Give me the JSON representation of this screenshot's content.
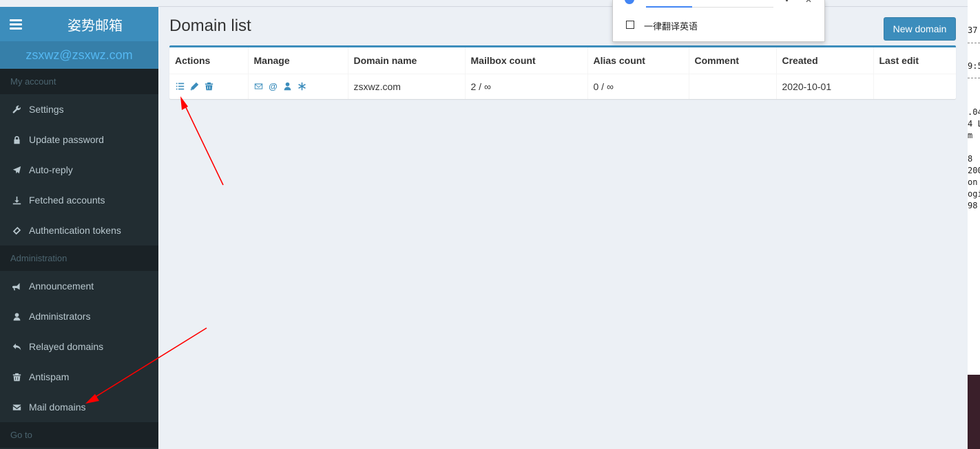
{
  "sidebar": {
    "brand": "姿势邮箱",
    "user_email": "zsxwz@zsxwz.com",
    "sections": [
      {
        "header": "My account",
        "items": [
          {
            "label": "Settings",
            "icon": "wrench-icon"
          },
          {
            "label": "Update password",
            "icon": "lock-icon"
          },
          {
            "label": "Auto-reply",
            "icon": "plane-icon"
          },
          {
            "label": "Fetched accounts",
            "icon": "download-icon"
          },
          {
            "label": "Authentication tokens",
            "icon": "ticket-icon"
          }
        ]
      },
      {
        "header": "Administration",
        "items": [
          {
            "label": "Announcement",
            "icon": "bullhorn-icon"
          },
          {
            "label": "Administrators",
            "icon": "user-icon"
          },
          {
            "label": "Relayed domains",
            "icon": "reply-icon"
          },
          {
            "label": "Antispam",
            "icon": "trash-icon"
          },
          {
            "label": "Mail domains",
            "icon": "envelope-icon"
          }
        ]
      },
      {
        "header": "Go to",
        "items": []
      }
    ]
  },
  "main": {
    "title": "Domain list",
    "new_button_label": "New domain",
    "table": {
      "columns": [
        "Actions",
        "Manage",
        "Domain name",
        "Mailbox count",
        "Alias count",
        "Comment",
        "Created",
        "Last edit"
      ],
      "rows": [
        {
          "actions": [
            "list-icon",
            "pencil-icon",
            "trash-icon"
          ],
          "manage": [
            "envelope-icon",
            "at-icon",
            "user-icon",
            "asterisk-icon"
          ],
          "domain_name": "zsxwz.com",
          "mailbox_count": "2 / ∞",
          "alias_count": "0 / ∞",
          "comment": "",
          "created": "2020-10-01",
          "last_edit": ""
        }
      ]
    }
  },
  "translate_popup": {
    "checkbox_label": "一律翻译英语"
  },
  "right_strip": {
    "lines": [
      "37",
      "9:5",
      ".04",
      "4 L",
      "m",
      "8",
      "200",
      "on",
      "ogi",
      " 98"
    ]
  },
  "colors": {
    "sidebar_bg": "#222d32",
    "brand_bg": "#3c8dbc",
    "user_bar_bg": "#367fa9",
    "accent": "#3c8dbc",
    "annotation_arrow": "#ff0000"
  }
}
